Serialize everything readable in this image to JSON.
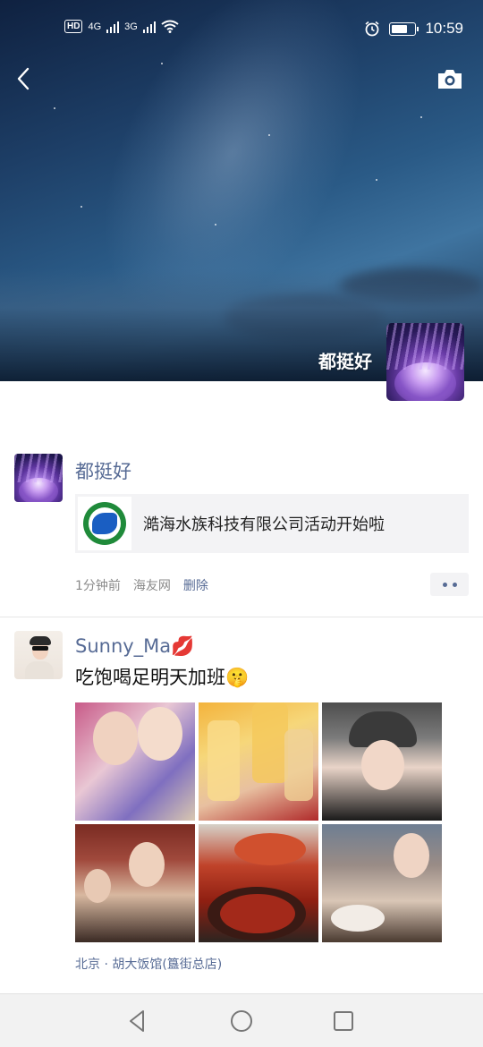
{
  "status_bar": {
    "hd": "HD",
    "net1": "4G",
    "net2": "3G",
    "time": "10:59",
    "battery_percent": 70
  },
  "header": {
    "back_icon": "chevron-left-icon",
    "camera_icon": "camera-icon"
  },
  "cover": {
    "user_name": "都挺好"
  },
  "posts": [
    {
      "author": "都挺好",
      "link_title": "澔海水族科技有限公司活动开始啦",
      "time_ago": "1分钟前",
      "source": "海友网",
      "delete_label": "删除"
    },
    {
      "author": "Sunny_Ma💋",
      "text": "吃饱喝足明天加班🤫",
      "location": "北京 · 胡大饭馆(簋街总店)"
    }
  ],
  "nav": {
    "back_icon": "triangle-back-icon",
    "home_icon": "circle-home-icon",
    "recent_icon": "square-recent-icon"
  }
}
